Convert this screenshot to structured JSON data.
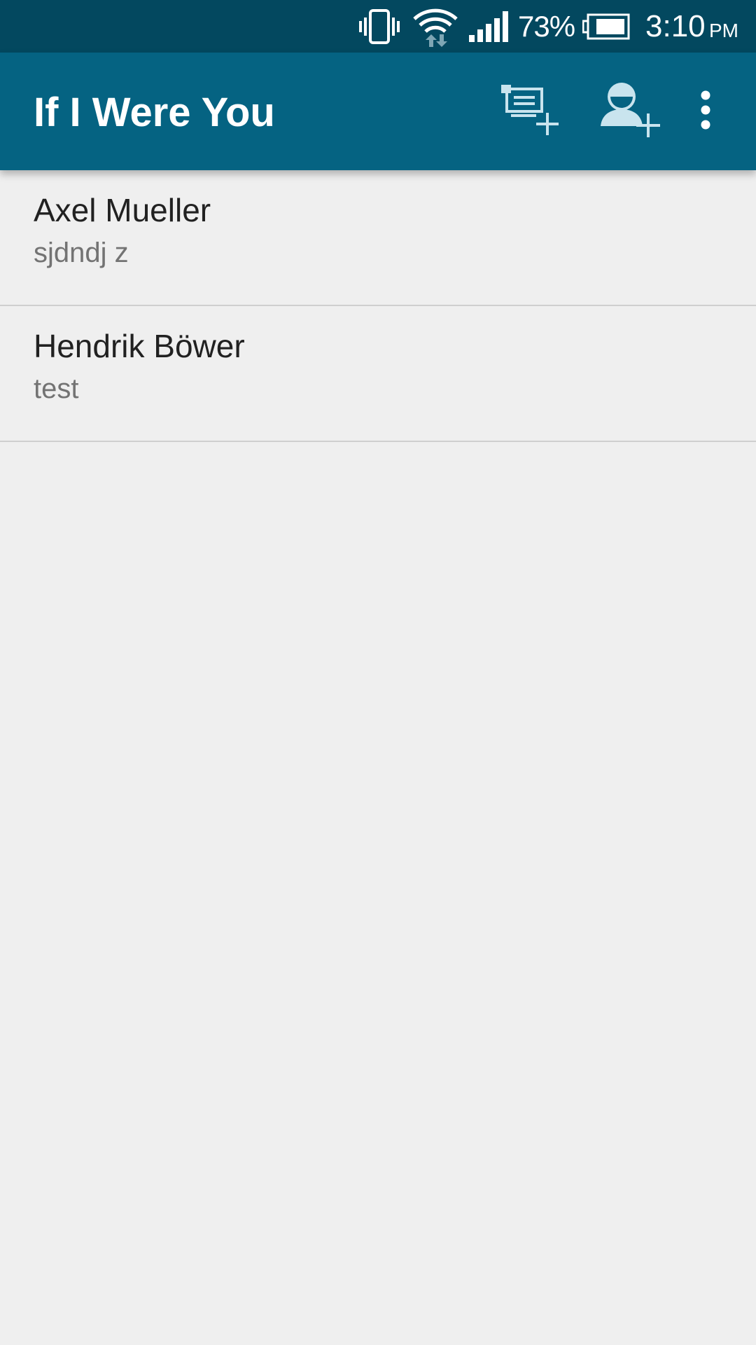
{
  "status_bar": {
    "battery_percent": "73%",
    "time": "3:10",
    "ampm": "PM",
    "icons": [
      "vibrate-icon",
      "wifi-icon",
      "cell-signal-icon",
      "battery-icon"
    ]
  },
  "app_bar": {
    "title": "If I Were You",
    "actions": [
      "add-group-icon",
      "add-person-icon",
      "overflow-menu-icon"
    ]
  },
  "list": {
    "items": [
      {
        "name": "Axel Mueller",
        "subtitle": "sjdndj z"
      },
      {
        "name": "Hendrik Böwer",
        "subtitle": "test"
      }
    ]
  },
  "colors": {
    "status_bar": "#03485f",
    "app_bar": "#056382",
    "background": "#efefef",
    "icon_tint": "#c9e4ee"
  }
}
